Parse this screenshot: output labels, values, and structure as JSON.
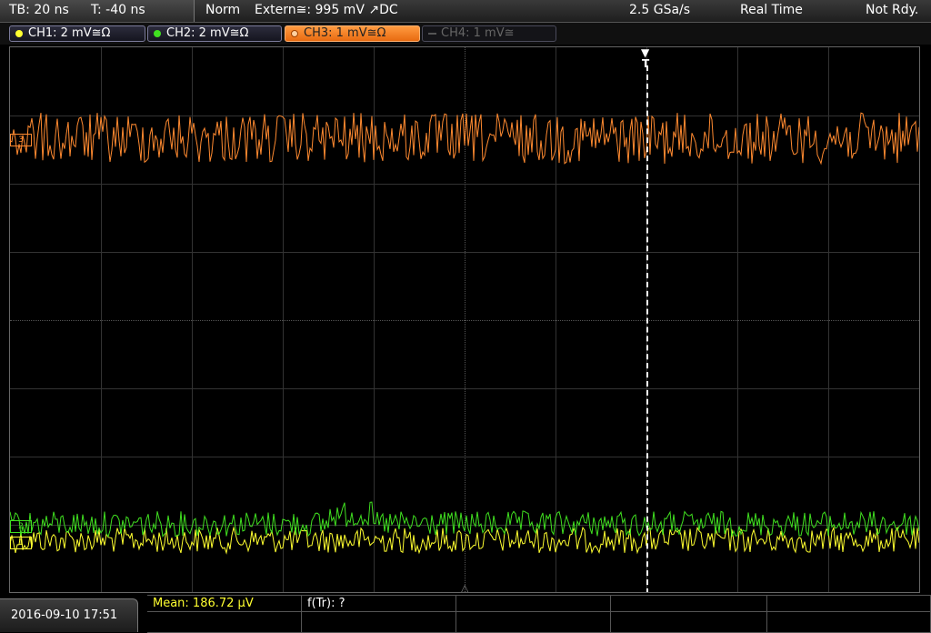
{
  "topbar": {
    "timebase": "TB: 20 ns",
    "trigger_time": "T: -40 ns",
    "mode": "Norm",
    "trigger_source": "Extern≅: 995 mV ↗DC",
    "sample_rate": "2.5 GSa/s",
    "acq_mode": "Real Time",
    "status": "Not Rdy."
  },
  "channels": [
    {
      "label": "CH1: 2 mV≅Ω",
      "color": "#ffff30"
    },
    {
      "label": "CH2: 2 mV≅Ω",
      "color": "#40e020"
    },
    {
      "label": "CH3: 1 mV≅Ω",
      "color": "#ff8a30"
    },
    {
      "label": "CH4: 1 mV≅",
      "color": "#555555"
    }
  ],
  "screen": {
    "trigger_label": "T",
    "ch3_marker": "3",
    "ch2_marker": "2",
    "ch1_marker": "1"
  },
  "bottom": {
    "datetime": "2016-09-10 17:51",
    "mean": "Mean: 186.72 µV",
    "freq": "f(Tr): ?"
  }
}
